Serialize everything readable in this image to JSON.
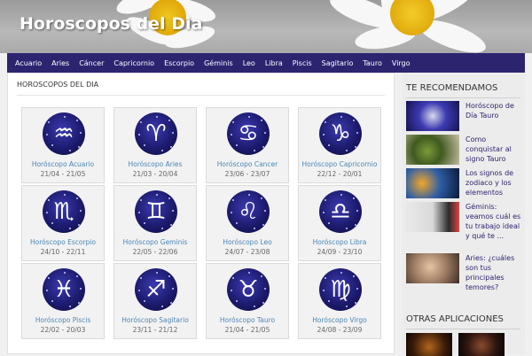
{
  "site": {
    "title": "Horoscopos del Dia"
  },
  "nav": [
    "Acuario",
    "Aries",
    "Cáncer",
    "Capricornio",
    "Escorpio",
    "Géminis",
    "Leo",
    "Libra",
    "Piscis",
    "Sagitario",
    "Tauro",
    "Virgo"
  ],
  "main": {
    "title": "HOROSCOPOS DEL DIA",
    "signs": [
      {
        "name": "Horóscopo Acuario",
        "dates": "21/04 - 21/05",
        "icon": "aquarius-icon",
        "glyph": "♒"
      },
      {
        "name": "Horóscopo Aries",
        "dates": "21/03 - 20/04",
        "icon": "aries-icon",
        "glyph": "♈"
      },
      {
        "name": "Horóscopo Cancer",
        "dates": "23/06 - 23/07",
        "icon": "cancer-icon",
        "glyph": "♋"
      },
      {
        "name": "Horóscopo Capricornio",
        "dates": "22/12 - 20/01",
        "icon": "capricorn-icon",
        "glyph": "♑"
      },
      {
        "name": "Horóscopo Escorpio",
        "dates": "24/10 - 22/11",
        "icon": "scorpio-icon",
        "glyph": "♏"
      },
      {
        "name": "Horóscopo Geminis",
        "dates": "22/05 - 22/06",
        "icon": "gemini-icon",
        "glyph": "♊"
      },
      {
        "name": "Horóscopo Leo",
        "dates": "24/07 - 23/08",
        "icon": "leo-icon",
        "glyph": "♌"
      },
      {
        "name": "Horóscopo Libra",
        "dates": "24/09 - 23/10",
        "icon": "libra-icon",
        "glyph": "♎"
      },
      {
        "name": "Horóscopo Piscis",
        "dates": "22/02 - 20/03",
        "icon": "pisces-icon",
        "glyph": "♓"
      },
      {
        "name": "Horóscopo Sagitario",
        "dates": "23/11 - 21/12",
        "icon": "sagittarius-icon",
        "glyph": "♐"
      },
      {
        "name": "Horóscopo Tauro",
        "dates": "21/04 - 21/05",
        "icon": "taurus-icon",
        "glyph": "♉"
      },
      {
        "name": "Horóscopo Virgo",
        "dates": "24/08 - 23/09",
        "icon": "virgo-icon",
        "glyph": "♍"
      }
    ]
  },
  "sidebar": {
    "recommended_title": "TE RECOMENDAMOS",
    "recommended": [
      {
        "text": "Horóscopo de Día Tauro"
      },
      {
        "text": "Como conquistar al signo Tauro"
      },
      {
        "text": "Los signos de zodiaco y los elementos"
      },
      {
        "text": "Géminis: veamos cuál es tu trabajo ideal y qué te ..."
      },
      {
        "text": "Aries: ¿cuáles son tus principales temores?"
      }
    ],
    "apps_title": "OTRAS APLICACIONES"
  },
  "colors": {
    "nav_bg": "#2d2470",
    "link": "#4b86b8",
    "sign_bg": "#1c1b6e"
  }
}
